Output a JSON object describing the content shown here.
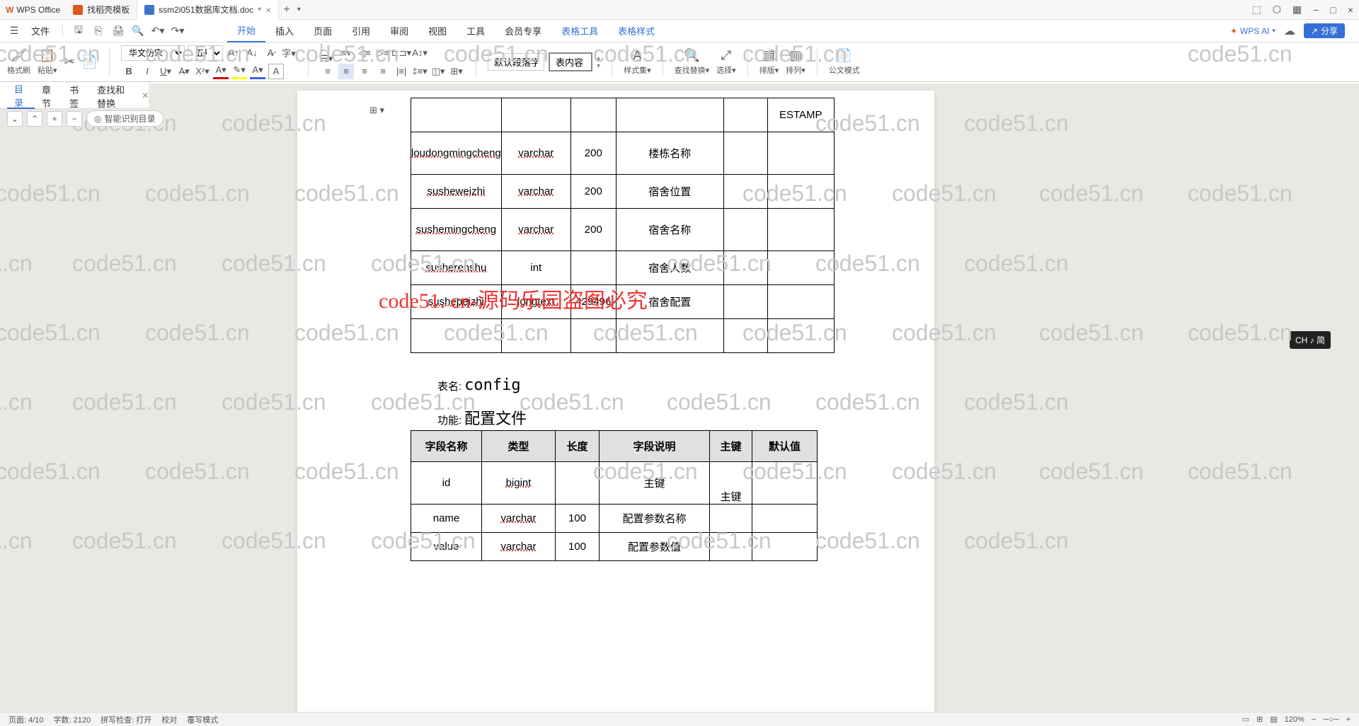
{
  "app": {
    "name": "WPS Office"
  },
  "tabs": [
    {
      "label": "找稻壳模板"
    },
    {
      "label": "ssm2i051数据库文档.doc"
    }
  ],
  "window_controls": {
    "minimize": "−",
    "maximize": "□",
    "close": "×"
  },
  "menu": {
    "file": "文件",
    "items": [
      "开始",
      "插入",
      "页面",
      "引用",
      "审阅",
      "视图",
      "工具",
      "会员专享",
      "表格工具",
      "表格样式"
    ],
    "wps_ai": "WPS AI",
    "share": "分享"
  },
  "ribbon": {
    "format_painter": "格式刷",
    "paste": "粘贴",
    "font_name": "华文仿宋",
    "font_size": "五号",
    "style_para": "默认段落字体",
    "style_content": "表内容",
    "styles": "样式集",
    "findreplace": "查找替换",
    "select": "选择",
    "rows": "排版",
    "cols": "排列",
    "gov": "公文模式"
  },
  "side_tabs": {
    "outline": "目录",
    "chapters": "章节",
    "bookmarks": "书签",
    "findreplace": "查找和替换"
  },
  "outline": {
    "smart": "智能识别目录"
  },
  "document": {
    "table1": {
      "rows": [
        {
          "c1": "",
          "c2": "",
          "c3": "",
          "c4": "",
          "c5": "",
          "c6": "ESTAMP"
        },
        {
          "c1": "loudongmingcheng",
          "c2": "varchar",
          "c3": "200",
          "c4": "楼栋名称",
          "c5": "",
          "c6": ""
        },
        {
          "c1": "susheweizhi",
          "c2": "varchar",
          "c3": "200",
          "c4": "宿舍位置",
          "c5": "",
          "c6": ""
        },
        {
          "c1": "sushemingcheng",
          "c2": "varchar",
          "c3": "200",
          "c4": "宿舍名称",
          "c5": "",
          "c6": ""
        },
        {
          "c1": "susherenshu",
          "c2": "int",
          "c3": "",
          "c4": "宿舍人数",
          "c5": "",
          "c6": ""
        },
        {
          "c1": "sushepeizhi",
          "c2": "longtext",
          "c3": "429496",
          "c4": "宿舍配置",
          "c5": "",
          "c6": ""
        },
        {
          "c1": "",
          "c2": "",
          "c3": "",
          "c4": "",
          "c5": "",
          "c6": ""
        }
      ]
    },
    "section": {
      "table_name_lbl": "表名:",
      "table_name": "config",
      "func_lbl": "功能:",
      "func": "配置文件"
    },
    "table2": {
      "headers": [
        "字段名称",
        "类型",
        "长度",
        "字段说明",
        "主键",
        "默认值"
      ],
      "rows": [
        {
          "c1": "id",
          "c2": "bigint",
          "c3": "",
          "c4": "主键",
          "c5": "主键",
          "c6": ""
        },
        {
          "c1": "name",
          "c2": "varchar",
          "c3": "100",
          "c4": "配置参数名称",
          "c5": "",
          "c6": ""
        },
        {
          "c1": "value",
          "c2": "varchar",
          "c3": "100",
          "c4": "配置参数值",
          "c5": "",
          "c6": ""
        }
      ]
    }
  },
  "watermark": {
    "text": "code51.cn",
    "big": "code51. cn-源码乐园盗图必究"
  },
  "ime": "CH ♪ 简",
  "status": {
    "page": "页面: 4/10",
    "words": "字数: 2120",
    "spell": "拼写检查: 打开",
    "proof": "校对",
    "overwrite": "覆写模式",
    "zoom": "120%"
  }
}
